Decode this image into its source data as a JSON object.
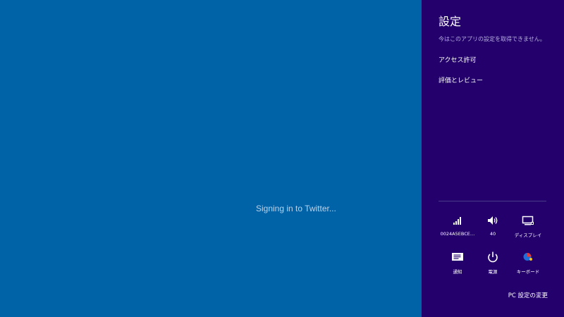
{
  "app": {
    "status_text": "Signing in to Twitter..."
  },
  "charm": {
    "title": "設定",
    "message": "今はこのアプリの設定を取得できません。",
    "links": [
      {
        "label": "アクセス許可"
      },
      {
        "label": "評価とレビュー"
      }
    ],
    "quick_settings": {
      "network": {
        "label": "0024A5EBCE…",
        "icon": "wifi-signal-icon"
      },
      "volume": {
        "label": "40",
        "icon": "speaker-icon"
      },
      "display": {
        "label": "ディスプレイ",
        "icon": "display-icon"
      },
      "notifications": {
        "label": "通知",
        "icon": "notification-icon"
      },
      "power": {
        "label": "電源",
        "icon": "power-icon"
      },
      "keyboard": {
        "label": "キーボード",
        "icon": "keyboard-ime-icon"
      }
    },
    "pc_settings_label": "PC 設定の変更"
  },
  "colors": {
    "app_background": "#0063a8",
    "charm_background": "#23006b",
    "status_text": "#b8d3ec"
  }
}
